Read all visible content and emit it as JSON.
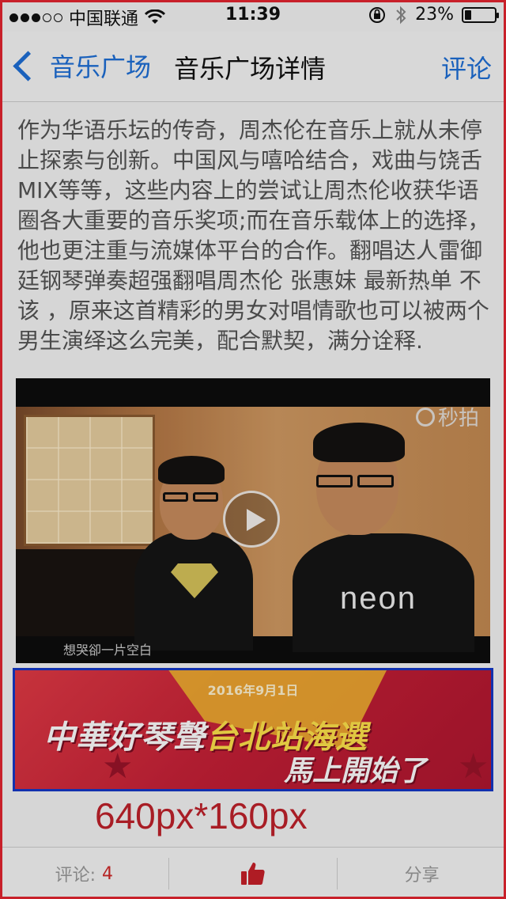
{
  "status_bar": {
    "carrier": "中国联通",
    "time": "11:39",
    "battery_percent": "23%",
    "battery_level": 0.23
  },
  "nav": {
    "back_label": "音乐广场",
    "title": "音乐广场详情",
    "right_label": "评论"
  },
  "article": {
    "text": "作为华语乐坛的传奇，周杰伦在音乐上就从未停止探索与创新。中国风与嘻哈结合，戏曲与饶舌MIX等等，这些内容上的尝试让周杰伦收获华语圈各大重要的音乐奖项;而在音乐载体上的选择，他也更注重与流媒体平台的合作。翻唱达人雷御廷钢琴弹奏超强翻唱周杰伦 张惠妹 最新热单 不该 ，原来这首精彩的男女对唱情歌也可以被两个男生演绎这么完美，配合默契，满分诠释."
  },
  "video": {
    "watermark": "秒拍",
    "subtitle": "想哭卻一片空白",
    "shirt_text": "neon"
  },
  "banner": {
    "date": "2016年9月1日",
    "line1_a": "中華好琴聲",
    "line1_b": "台北站海選",
    "line2": "馬上開始了"
  },
  "size_caption": "640px*160px",
  "toolbar": {
    "comment_label": "评论:",
    "comment_count": "4",
    "share_label": "分享"
  },
  "colors": {
    "accent_blue": "#1e6fd6",
    "frame_red": "#c8202a",
    "banner_border": "#1538c8",
    "count_red": "#d02828"
  }
}
